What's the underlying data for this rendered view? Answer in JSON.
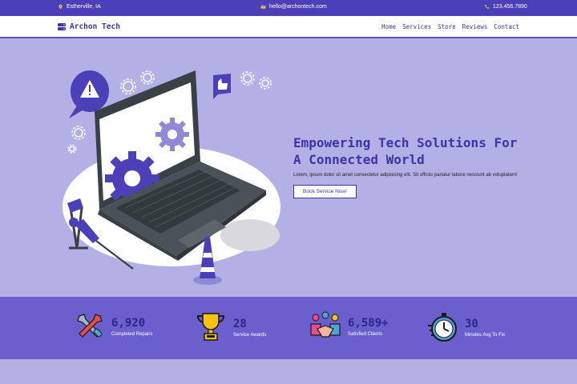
{
  "topbar": {
    "location": "Estherville, IA",
    "email": "hello@archontech.com",
    "phone": "123.456.7890"
  },
  "brand": {
    "name": "Archon Tech"
  },
  "nav": {
    "items": [
      "Home",
      "Services",
      "Store",
      "Reviews",
      "Contact"
    ]
  },
  "hero": {
    "title": "Empowering Tech Solutions For A Connected World",
    "description": "Lorem, ipsum dolor sit amet consectetur adipisicing elit. Sit officiis pariatur labore nesciunt ab voluptatem!",
    "button_label": "Book Service Now!"
  },
  "stats": [
    {
      "value": "6,920",
      "label": "Completed Repairs",
      "icon": "tools-icon"
    },
    {
      "value": "28",
      "label": "Service Awards",
      "icon": "trophy-icon"
    },
    {
      "value": "6,589+",
      "label": "Satisfied Clients",
      "icon": "handshake-icon"
    },
    {
      "value": "30",
      "label": "Minutes Avg To Fix",
      "icon": "stopwatch-icon"
    }
  ],
  "colors": {
    "topbar": "#4b40b8",
    "hero_bg": "#b3b0e6",
    "stats_bg": "#6a5fcd",
    "accent": "#3d33a8"
  }
}
